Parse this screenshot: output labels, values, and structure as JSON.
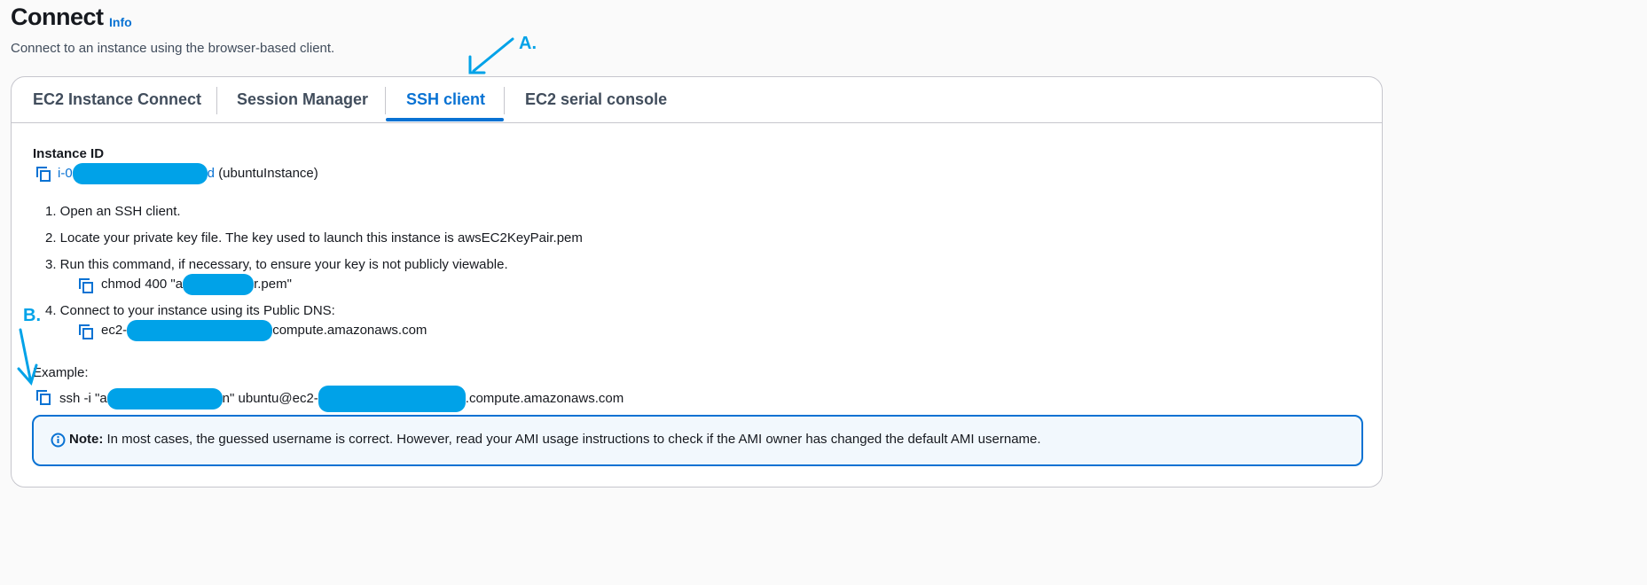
{
  "header": {
    "title": "Connect",
    "info_link": "Info",
    "subtitle": "Connect to an instance using the browser-based client."
  },
  "tabs": [
    {
      "label": "EC2 Instance Connect"
    },
    {
      "label": "Session Manager"
    },
    {
      "label": "SSH client",
      "active": true
    },
    {
      "label": "EC2 serial console"
    }
  ],
  "instance": {
    "label": "Instance ID",
    "id_prefix": "i-0",
    "id_suffix": "d",
    "name": "(ubuntuInstance)"
  },
  "steps": {
    "s1": "1. Open an SSH client.",
    "s2": "2. Locate your private key file. The key used to launch this instance is awsEC2KeyPair.pem",
    "s3": "3. Run this command, if necessary, to ensure your key is not publicly viewable.",
    "s3_cmd_prefix": "chmod 400 \"a",
    "s3_cmd_suffix": "r.pem\"",
    "s4": "4. Connect to your instance using its Public DNS:",
    "s4_dns_prefix": "ec2-",
    "s4_dns_suffix": "compute.amazonaws.com"
  },
  "example": {
    "label": "Example:",
    "cmd_prefix": "ssh -i \"a",
    "cmd_middle": "n\" ubuntu@ec2-",
    "cmd_suffix": ".compute.amazonaws.com"
  },
  "note": {
    "bold": "Note:",
    "text": " In most cases, the guessed username is correct. However, read your AMI usage instructions to check if the AMI owner has changed the default AMI username."
  },
  "annotations": {
    "a": "A.",
    "b": "B."
  },
  "colors": {
    "accent": "#0972d3",
    "annotation": "#00a2e8"
  }
}
